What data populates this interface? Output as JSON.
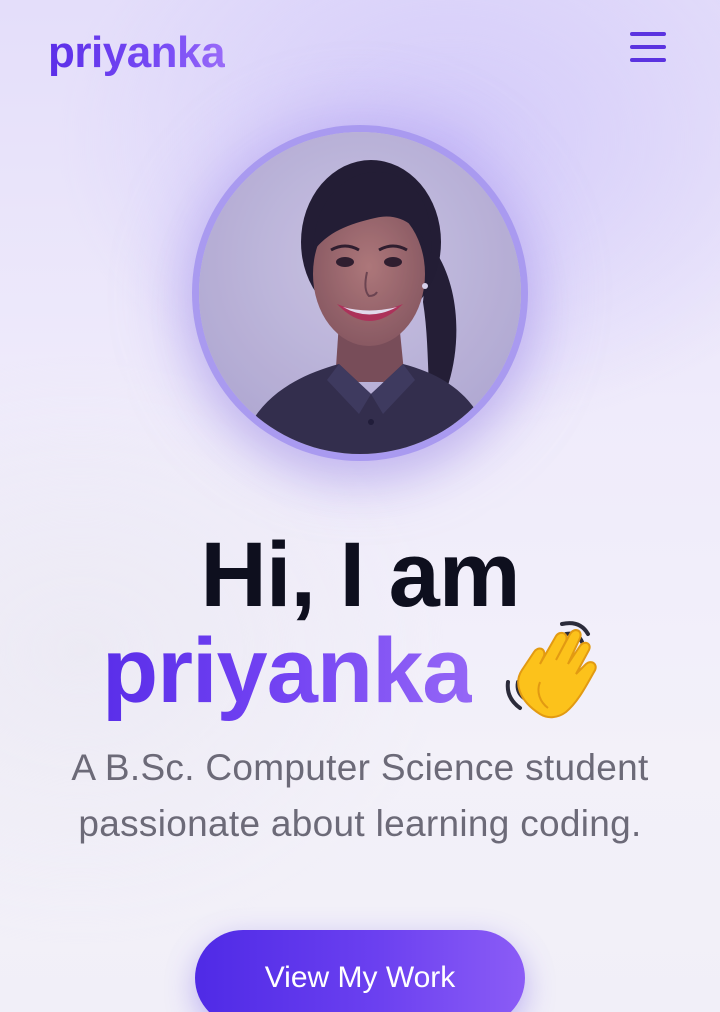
{
  "navbar": {
    "brand": "priyanka",
    "menu_icon": "hamburger-menu-icon"
  },
  "profile": {
    "avatar_description_icon": "profile-photo"
  },
  "hero": {
    "greeting": "Hi, I am",
    "name": "priyanka",
    "emoji": "👋",
    "emoji_icon": "waving-hand-icon",
    "subtitle_line1": "A B.Sc. Computer Science student",
    "subtitle_line2": "passionate about learning coding.",
    "cta_label": "View My Work"
  },
  "colors": {
    "accent": "#6d3ff0",
    "accent_light": "#9567f6",
    "heading": "#0e0f1e",
    "body_text": "#6c6a78",
    "avatar_ring": "#a99af0"
  }
}
